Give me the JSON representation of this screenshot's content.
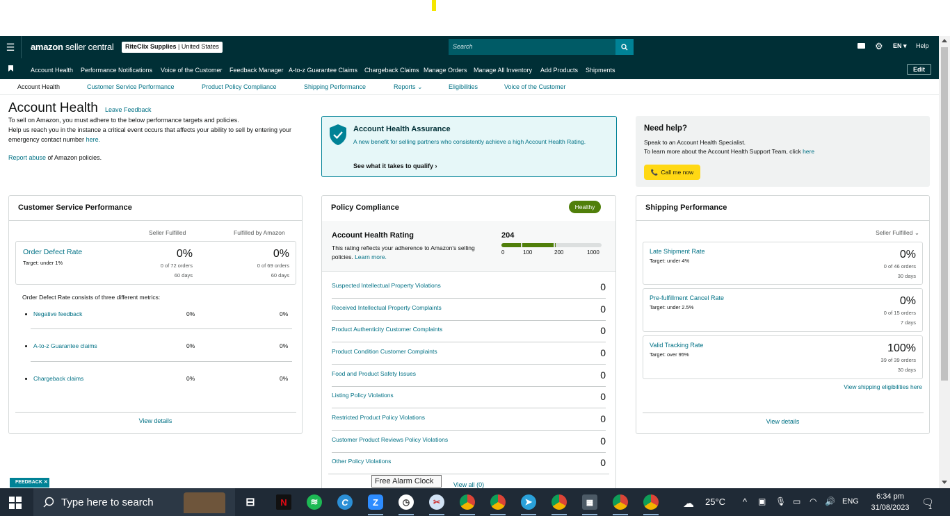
{
  "header": {
    "logo": "amazon",
    "logo_rest": " seller central",
    "store_name": "RiteClix Supplies",
    "store_region": " | United States",
    "search_placeholder": "Search",
    "lang": "EN ▾",
    "help": "Help"
  },
  "nav": {
    "items": [
      "Account Health",
      "Performance Notifications",
      "Voice of the Customer",
      "Feedback Manager",
      "A-to-z Guarantee Claims",
      "Chargeback Claims",
      "Manage Orders",
      "Manage All Inventory",
      "Add Products",
      "Shipments"
    ],
    "edit": "Edit"
  },
  "subtabs": [
    "Account Health",
    "Customer Service Performance",
    "Product Policy Compliance",
    "Shipping Performance",
    "Reports ⌄",
    "Eligibilities",
    "Voice of the Customer"
  ],
  "intro": {
    "title": "Account Health",
    "leave_feedback": "Leave Feedback",
    "line1": "To sell on Amazon, you must adhere to the below performance targets and policies.",
    "line2a": "Help us reach you in the instance a critical event occurs that affects your ability to sell by entering your emergency contact number ",
    "line2_link": "here.",
    "report_link": "Report abuse",
    "report_rest": " of Amazon policies."
  },
  "assurance": {
    "title": "Account Health Assurance",
    "text": "A new benefit for selling partners who consistently achieve a high Account Health Rating.",
    "link": "See what it takes to qualify  ›"
  },
  "needhelp": {
    "title": "Need help?",
    "line1": "Speak to an Account Health Specialist.",
    "line2": "To learn more about the Account Health Support Team, click ",
    "line2_link": "here",
    "call": "Call me now"
  },
  "csp": {
    "title": "Customer Service Performance",
    "col1": "Seller Fulfilled",
    "col2": "Fulfilled by Amazon",
    "odr_label": "Order Defect Rate",
    "odr_target": "Target: under 1%",
    "odr_sf": "0%",
    "odr_sf_orders": "0 of 72 orders",
    "odr_sf_days": "60 days",
    "odr_fba": "0%",
    "odr_fba_orders": "0 of 69 orders",
    "odr_fba_days": "60 days",
    "metrics_intro": "Order Defect Rate consists of three different metrics:",
    "metrics": [
      {
        "label": "Negative feedback",
        "sf": "0%",
        "fba": "0%"
      },
      {
        "label": "A-to-z Guarantee claims",
        "sf": "0%",
        "fba": "0%"
      },
      {
        "label": "Chargeback claims",
        "sf": "0%",
        "fba": "0%"
      }
    ],
    "view_details": "View details"
  },
  "policy": {
    "title": "Policy Compliance",
    "badge": "Healthy",
    "ahr_title": "Account Health Rating",
    "ahr_text": "This rating reflects your adherence to Amazon's selling policies. ",
    "ahr_link": "Learn more.",
    "ahr_score": "204",
    "ticks": [
      "0",
      "100",
      "200",
      "1000"
    ],
    "rows": [
      {
        "label": "Suspected Intellectual Property Violations",
        "value": "0"
      },
      {
        "label": "Received Intellectual Property Complaints",
        "value": "0"
      },
      {
        "label": "Product Authenticity Customer Complaints",
        "value": "0"
      },
      {
        "label": "Product Condition Customer Complaints",
        "value": "0"
      },
      {
        "label": "Food and Product Safety Issues",
        "value": "0"
      },
      {
        "label": "Listing Policy Violations",
        "value": "0"
      },
      {
        "label": "Restricted Product Policy Violations",
        "value": "0"
      },
      {
        "label": "Customer Product Reviews Policy Violations",
        "value": "0"
      },
      {
        "label": "Other Policy Violations",
        "value": "0"
      }
    ],
    "view_all": "View all (0)"
  },
  "shipping": {
    "title": "Shipping Performance",
    "selector": "Seller Fulfilled  ⌄",
    "metrics": [
      {
        "label": "Late Shipment Rate",
        "target": "Target: under 4%",
        "value": "0%",
        "orders": "0 of 46 orders",
        "days": "30 days"
      },
      {
        "label": "Pre-fulfillment Cancel Rate",
        "target": "Target: under 2.5%",
        "value": "0%",
        "orders": "0 of 15 orders",
        "days": "7 days"
      },
      {
        "label": "Valid Tracking Rate",
        "target": "Target: over 95%",
        "value": "100%",
        "orders": "39 of 39 orders",
        "days": "30 days"
      }
    ],
    "eligibilities": "View shipping eligibilities here",
    "view_details": "View details"
  },
  "feedback_tag": "FEEDBACK ✕",
  "tooltip": "Free Alarm Clock",
  "taskbar": {
    "search": "Type here to search",
    "temp": "25°C",
    "lang": "ENG",
    "time": "6:34 pm",
    "date": "31/08/2023",
    "notif_count": "1"
  },
  "colors": {
    "header": "#002f36",
    "link": "#007185",
    "healthy": "#507f0a",
    "call_btn": "#ffd814"
  }
}
